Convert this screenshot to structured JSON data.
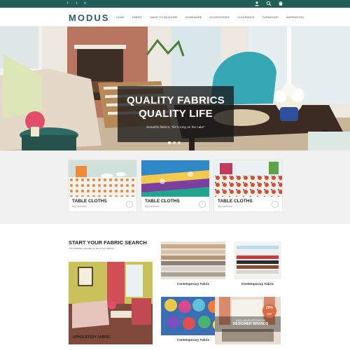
{
  "brand": {
    "logo": "MODUS",
    "accent": "#1f5f58"
  },
  "topbar": {
    "social_icons": [
      "facebook-icon",
      "twitter-icon",
      "rss-icon"
    ],
    "right_icons": [
      "user-icon",
      "search-icon",
      "cart-icon"
    ]
  },
  "nav": {
    "items": [
      "HOME",
      "FABRIC",
      "MADE TO MEASURE",
      "HOMEWARE",
      "ACCESSORIES",
      "CLEARANCE",
      "FURNITURE",
      "INSPIRATION"
    ],
    "active": "HOME"
  },
  "hero": {
    "line1": "QUALITY FABRICS",
    "line2": "QUALITY LIFE",
    "subtitle": "Beautiful fabrics, \"life's icing on the cake\"",
    "slides": 3,
    "active_slide": 1
  },
  "categories": [
    {
      "title": "TABLE CLOTHS",
      "subtitle": "Big Selection"
    },
    {
      "title": "TABLE CLOTHS",
      "subtitle": "Big Selection"
    },
    {
      "title": "TABLE CLOTHS",
      "subtitle": "Big Selection"
    }
  ],
  "fabric_search": {
    "title": "START YOUR FABRIC SEARCH",
    "subtitle": "Get fantastic savings on all of our fabrics",
    "tiles": [
      {
        "label": "Contemporary Fabric"
      },
      {
        "label": "Contemporary Fabric"
      },
      {
        "label": "UPHOLSTERY FABRIC"
      },
      {
        "label": "Contemporary Fabric"
      }
    ],
    "promo": {
      "badge_value": "20%",
      "badge_unit": "OFF",
      "line1": "EXCLUSIVE OFFERS ON",
      "line2": "DESIGNER BRANDS"
    }
  }
}
